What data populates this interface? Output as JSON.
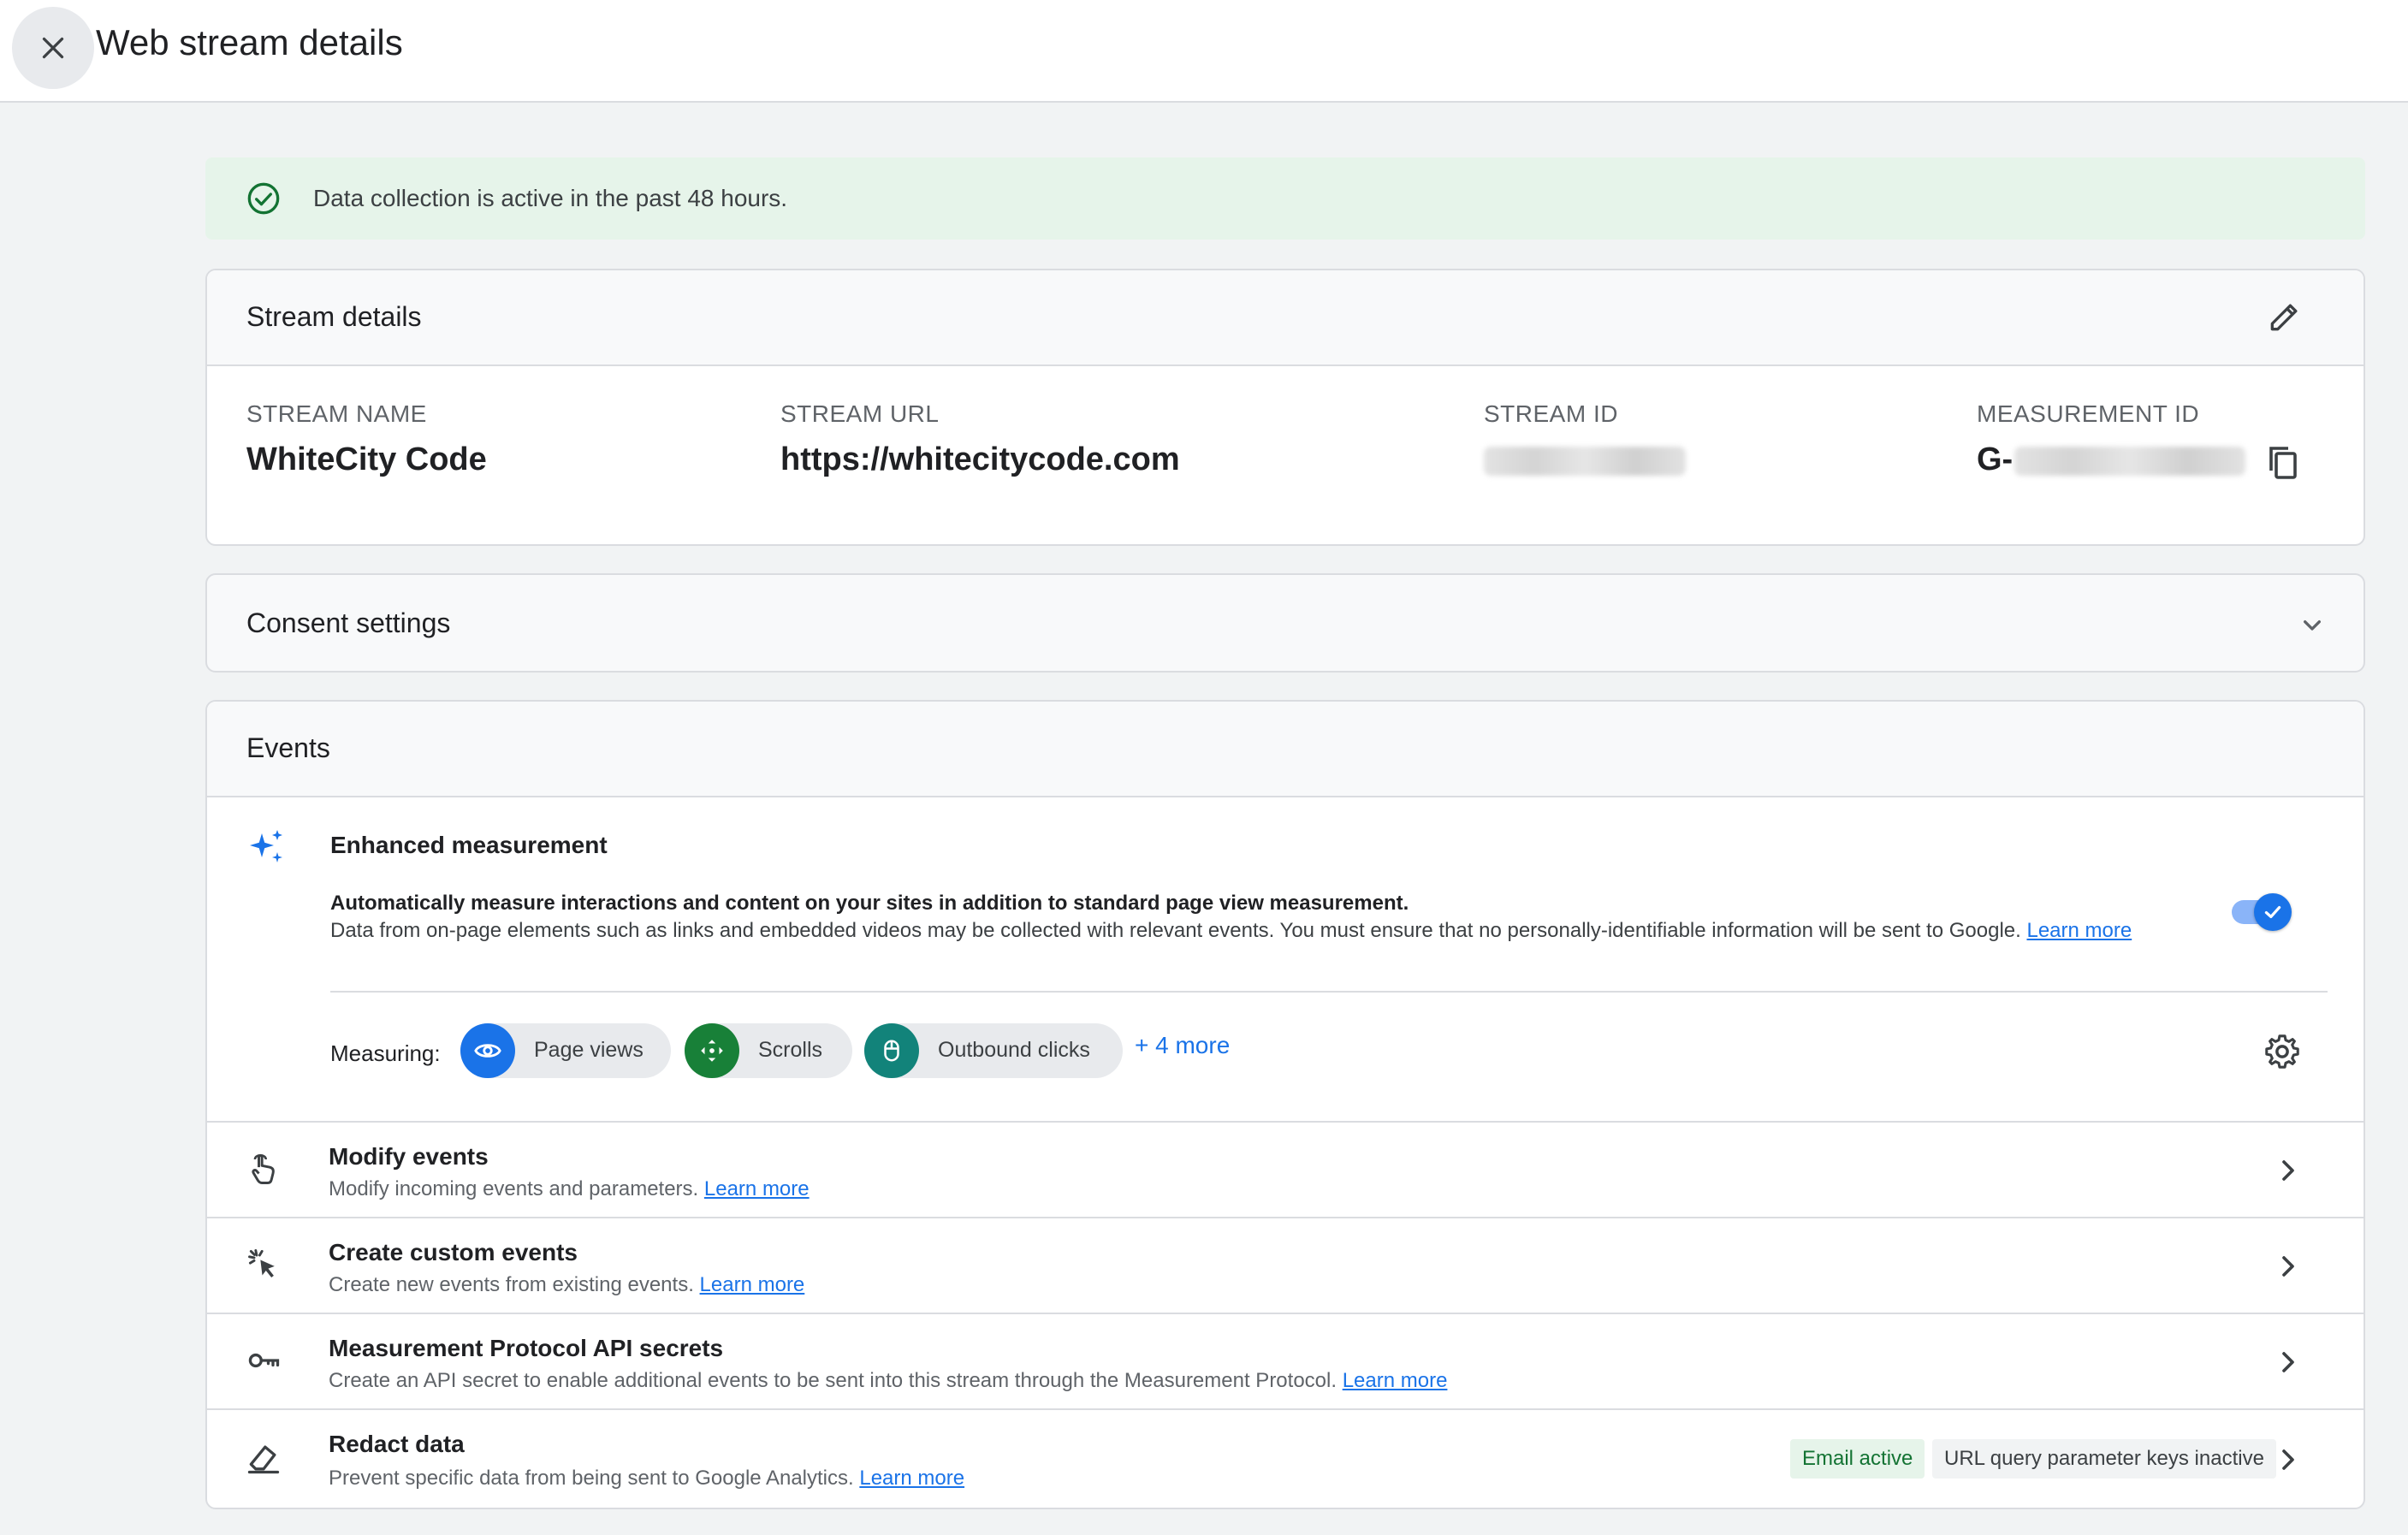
{
  "header": {
    "title": "Web stream details"
  },
  "banner": {
    "text": "Data collection is active in the past 48 hours.",
    "color": "#137333"
  },
  "stream_details": {
    "title": "Stream details",
    "fields": {
      "name_label": "STREAM NAME",
      "name_value": "WhiteCity Code",
      "url_label": "STREAM URL",
      "url_value": "https://whitecitycode.com",
      "id_label": "STREAM ID",
      "measurement_label": "MEASUREMENT ID",
      "measurement_prefix": "G-"
    }
  },
  "consent": {
    "title": "Consent settings"
  },
  "events": {
    "title": "Events",
    "enhanced": {
      "title": "Enhanced measurement",
      "line1": "Automatically measure interactions and content on your sites in addition to standard page view measurement.",
      "line2": "Data from on-page elements such as links and embedded videos may be collected with relevant events. You must ensure that no personally-identifiable information will be sent to Google.",
      "learn": "Learn more",
      "measuring_label": "Measuring:",
      "chips": [
        {
          "label": "Page views",
          "color": "#1a73e8",
          "icon": "eye-icon"
        },
        {
          "label": "Scrolls",
          "color": "#188038",
          "icon": "scroll-icon"
        },
        {
          "label": "Outbound clicks",
          "color": "#12837a",
          "icon": "mouse-icon"
        }
      ],
      "more": "+ 4 more",
      "toggle_on": true
    },
    "rows": [
      {
        "title": "Modify events",
        "desc": "Modify incoming events and parameters.",
        "learn": "Learn more"
      },
      {
        "title": "Create custom events",
        "desc": "Create new events from existing events.",
        "learn": "Learn more"
      },
      {
        "title": "Measurement Protocol API secrets",
        "desc": "Create an API secret to enable additional events to be sent into this stream through the Measurement Protocol.",
        "learn": "Learn more"
      },
      {
        "title": "Redact data",
        "desc": "Prevent specific data from being sent to Google Analytics.",
        "learn": "Learn more",
        "badges": [
          "Email active",
          "URL query parameter keys inactive"
        ]
      }
    ]
  },
  "colors": {
    "accent": "#1a73e8",
    "success_bg": "#e6f4ea",
    "divider": "#dadce0"
  }
}
